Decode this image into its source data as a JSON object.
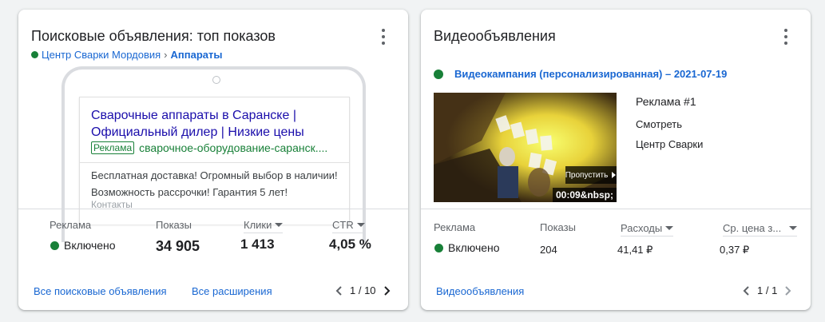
{
  "search_card": {
    "title": "Поисковые объявления: топ показов",
    "breadcrumb": {
      "parent": "Центр Сварки Мордовия",
      "separator": "›",
      "current": "Аппараты"
    },
    "ad": {
      "headline": "Сварочные аппараты в Саранске | Официальный дилер | Низкие цены",
      "badge": "Реклама",
      "display_url": "сварочное-оборудование-саранск....",
      "description": "Бесплатная доставка! Огромный выбор в наличии! Возможность рассрочки! Гарантия 5 лет!",
      "extension": "Контакты"
    },
    "stats": {
      "ad_label": "Реклама",
      "status": "Включено",
      "impressions_label": "Показы",
      "impressions": "34 905",
      "clicks_label": "Клики",
      "clicks": "1 413",
      "ctr_label": "CTR",
      "ctr": "4,05 %"
    },
    "footer": {
      "link_all_ads": "Все поисковые объявления",
      "link_all_extensions": "Все расширения",
      "page": "1 / 10"
    }
  },
  "video_card": {
    "title": "Видеообъявления",
    "campaign": "Видеокампания (персонализированная) – 2021-07-19",
    "thumbnail": {
      "skip_label": "Пропустить",
      "time": "00:09&nbsp;"
    },
    "meta": {
      "ad_name": "Реклама #1",
      "action": "Смотреть",
      "advertiser": "Центр Сварки"
    },
    "stats": {
      "ad_label": "Реклама",
      "status": "Включено",
      "impressions_label": "Показы",
      "impressions": "204",
      "cost_label": "Расходы",
      "cost": "41,41 ₽",
      "avg_price_label": "Ср. цена з...",
      "avg_price": "0,37 ₽"
    },
    "footer": {
      "link_all": "Видеообъявления",
      "page": "1 / 1"
    }
  },
  "colors": {
    "status_green": "#188038",
    "link_blue": "#1967d2",
    "ad_headline": "#1a0dab"
  }
}
